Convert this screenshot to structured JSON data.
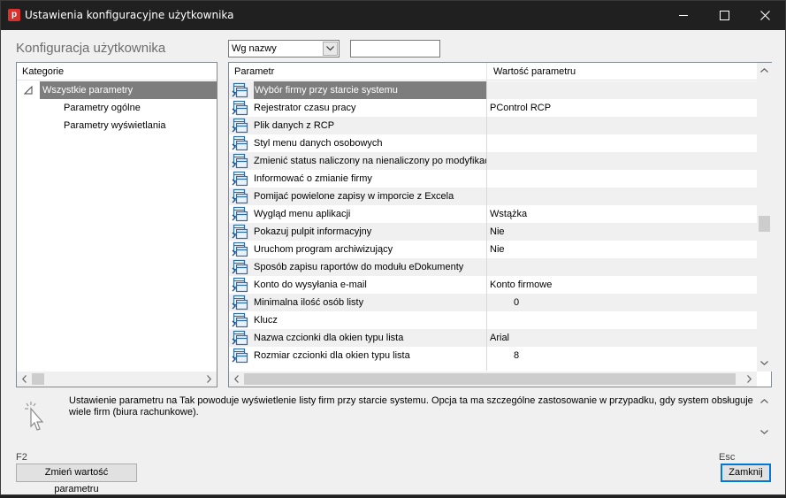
{
  "window": {
    "title": "Ustawienia konfiguracyjne użytkownika",
    "app_icon_letter": "p"
  },
  "heading": "Konfiguracja użytkownika",
  "sort": {
    "selected": "Wg nazwy"
  },
  "search": {
    "value": ""
  },
  "categories": {
    "header": "Kategorie",
    "items": [
      {
        "label": "Wszystkie parametry",
        "selected": true
      },
      {
        "label": "Parametry ogólne"
      },
      {
        "label": "Parametry wyświetlania"
      }
    ]
  },
  "params": {
    "headers": {
      "name": "Parametr",
      "value": "Wartość parametru"
    },
    "rows": [
      {
        "name": "Wybór firmy przy starcie systemu",
        "value": ""
      },
      {
        "name": "Rejestrator czasu pracy",
        "value": "PControl RCP"
      },
      {
        "name": "Plik danych z RCP",
        "value": ""
      },
      {
        "name": "Styl menu danych osobowych",
        "value": ""
      },
      {
        "name": "Zmienić status naliczony na nienaliczony po modyfikac",
        "value": ""
      },
      {
        "name": "Informować o zmianie firmy",
        "value": ""
      },
      {
        "name": "Pomijać powielone zapisy w imporcie z Excela",
        "value": ""
      },
      {
        "name": "Wygląd menu aplikacji",
        "value": "Wstążka"
      },
      {
        "name": "Pokazuj pulpit informacyjny",
        "value": "Nie"
      },
      {
        "name": "Uruchom program archiwizujący",
        "value": "Nie"
      },
      {
        "name": "Sposób zapisu raportów do modułu eDokumenty",
        "value": ""
      },
      {
        "name": "Konto do wysyłania e-mail",
        "value": "Konto firmowe"
      },
      {
        "name": "Minimalna ilość osób listy",
        "value": "0"
      },
      {
        "name": "Klucz",
        "value": ""
      },
      {
        "name": "Nazwa czcionki dla okien typu lista",
        "value": "Arial"
      },
      {
        "name": "Rozmiar czcionki dla okien typu lista",
        "value": "8"
      }
    ]
  },
  "description": "Ustawienie parametru na Tak powoduje wyświetlenie listy firm przy starcie systemu. Opcja ta ma szczególne zastosowanie w przypadku, gdy system obsługuje wiele firm (biura rachunkowe).",
  "footer": {
    "change_shortcut": "F2",
    "change_label": "Zmień wartość parametru",
    "close_shortcut": "Esc",
    "close_label": "Zamknij"
  }
}
